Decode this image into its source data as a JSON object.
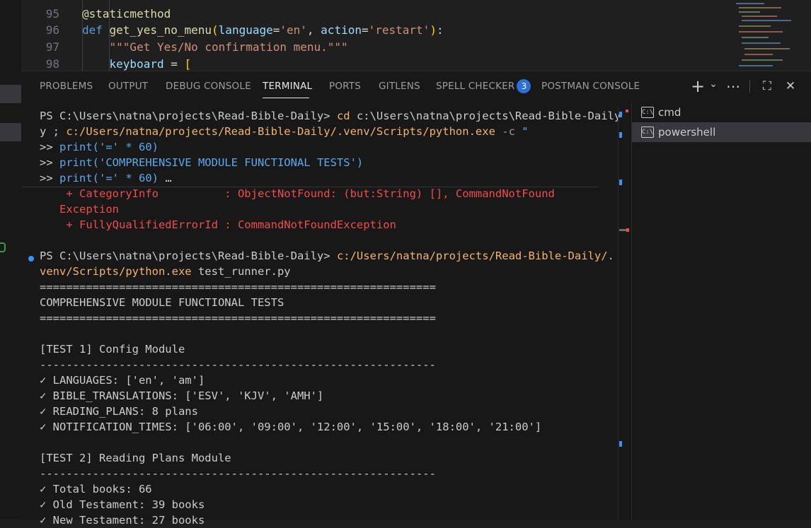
{
  "editor": {
    "lines": [
      {
        "num": "95",
        "tokens": [
          {
            "c": "deco",
            "t": "@staticmethod"
          }
        ]
      },
      {
        "num": "96",
        "tokens": [
          {
            "c": "kw",
            "t": "def "
          },
          {
            "c": "fn",
            "t": "get_yes_no_menu"
          },
          {
            "c": "br",
            "t": "("
          },
          {
            "c": "param",
            "t": "language"
          },
          {
            "c": "op",
            "t": "="
          },
          {
            "c": "str",
            "t": "'en'"
          },
          {
            "c": "op",
            "t": ", "
          },
          {
            "c": "param",
            "t": "action"
          },
          {
            "c": "op",
            "t": "="
          },
          {
            "c": "str",
            "t": "'restart'"
          },
          {
            "c": "br",
            "t": ")"
          },
          {
            "c": "op",
            "t": ":"
          }
        ]
      },
      {
        "num": "97",
        "tokens": [
          {
            "c": "str",
            "t": "    \"\"\"Get Yes/No confirmation menu.\"\"\""
          }
        ]
      },
      {
        "num": "98",
        "tokens": [
          {
            "c": "var",
            "t": "    keyboard "
          },
          {
            "c": "op",
            "t": "= "
          },
          {
            "c": "br",
            "t": "["
          }
        ]
      }
    ]
  },
  "panel": {
    "tabs": [
      "PROBLEMS",
      "OUTPUT",
      "DEBUG CONSOLE",
      "TERMINAL",
      "PORTS",
      "GITLENS",
      "SPELL CHECKER",
      "POSTMAN CONSOLE"
    ],
    "active_tab": "TERMINAL",
    "spell_checker_count": "3"
  },
  "terminal": {
    "lines": [
      [
        {
          "c": "t-w",
          "t": "PS C:\\Users\\natna\\projects\\Read-Bible-Daily> "
        },
        {
          "c": "t-y",
          "t": "cd "
        },
        {
          "c": "t-w",
          "t": "c:\\Users\\natna\\projects\\Read-Bible-Daily"
        }
      ],
      [
        {
          "c": "t-w",
          "t": "y ; "
        },
        {
          "c": "t-y",
          "t": "c:/Users/natna/projects/Read-Bible-Daily/.venv/Scripts/python.exe "
        },
        {
          "c": "t-gray",
          "t": "-c "
        },
        {
          "c": "t-cyan",
          "t": "\""
        }
      ],
      [
        {
          "c": "t-w",
          "t": ">> "
        },
        {
          "c": "t-cyan",
          "t": "print('=' * 60)"
        }
      ],
      [
        {
          "c": "t-w",
          "t": ">> "
        },
        {
          "c": "t-cyan",
          "t": "print('COMPREHENSIVE MODULE FUNCTIONAL TESTS')"
        }
      ],
      [
        {
          "c": "t-w",
          "t": ">> "
        },
        {
          "c": "t-cyan",
          "t": "print('=' * 60)"
        },
        {
          "c": "t-w",
          "t": " …"
        }
      ],
      [
        {
          "c": "t-red",
          "t": "    + CategoryInfo          : ObjectNotFound: (but:String) [], CommandNotFound"
        }
      ],
      [
        {
          "c": "t-red",
          "t": "   Exception"
        }
      ],
      [
        {
          "c": "t-red",
          "t": "    + FullyQualifiedErrorId : CommandNotFoundException"
        }
      ],
      [
        {
          "c": "t-w",
          "t": " "
        }
      ],
      [
        {
          "c": "t-w",
          "t": "PS C:\\Users\\natna\\projects\\Read-Bible-Daily> "
        },
        {
          "c": "t-y",
          "t": "c:/Users/natna/projects/Read-Bible-Daily/."
        }
      ],
      [
        {
          "c": "t-y",
          "t": "venv/Scripts/python.exe "
        },
        {
          "c": "t-w",
          "t": "test_runner.py"
        }
      ],
      [
        {
          "c": "t-w",
          "t": "============================================================"
        }
      ],
      [
        {
          "c": "t-w",
          "t": "COMPREHENSIVE MODULE FUNCTIONAL TESTS"
        }
      ],
      [
        {
          "c": "t-w",
          "t": "============================================================"
        }
      ],
      [
        {
          "c": "t-w",
          "t": " "
        }
      ],
      [
        {
          "c": "t-w",
          "t": "[TEST 1] Config Module"
        }
      ],
      [
        {
          "c": "t-w",
          "t": "------------------------------------------------------------"
        }
      ],
      [
        {
          "c": "t-w",
          "t": "✓ LANGUAGES: ['en', 'am']"
        }
      ],
      [
        {
          "c": "t-w",
          "t": "✓ BIBLE_TRANSLATIONS: ['ESV', 'KJV', 'AMH']"
        }
      ],
      [
        {
          "c": "t-w",
          "t": "✓ READING_PLANS: 8 plans"
        }
      ],
      [
        {
          "c": "t-w",
          "t": "✓ NOTIFICATION_TIMES: ['06:00', '09:00', '12:00', '15:00', '18:00', '21:00']"
        }
      ],
      [
        {
          "c": "t-w",
          "t": " "
        }
      ],
      [
        {
          "c": "t-w",
          "t": "[TEST 2] Reading Plans Module"
        }
      ],
      [
        {
          "c": "t-w",
          "t": "------------------------------------------------------------"
        }
      ],
      [
        {
          "c": "t-w",
          "t": "✓ Total books: 66"
        }
      ],
      [
        {
          "c": "t-w",
          "t": "✓ Old Testament: 39 books"
        }
      ],
      [
        {
          "c": "t-w",
          "t": "✓ New Testament: 27 books"
        }
      ]
    ]
  },
  "terminal_list": [
    {
      "name": "cmd",
      "icon": "terminal-icon",
      "warning": true
    },
    {
      "name": "powershell",
      "icon": "terminal-icon",
      "selected": true
    }
  ],
  "icons": {
    "new_terminal": "+",
    "chevron": "⌄",
    "more": "⋯",
    "maximize": "⛶",
    "close": "✕",
    "warning": "⚠"
  }
}
